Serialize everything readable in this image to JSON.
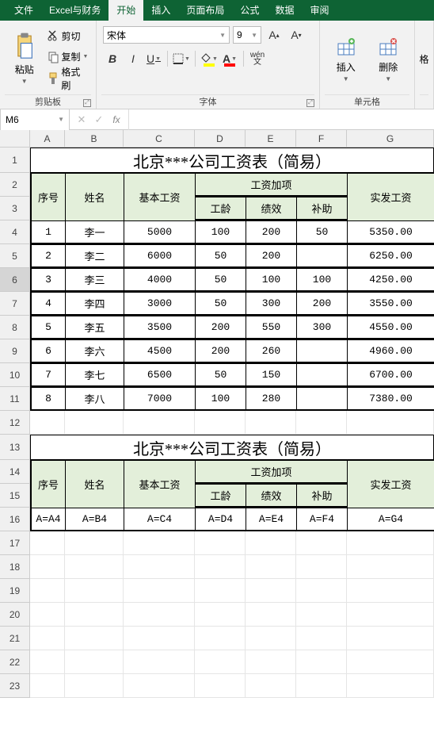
{
  "menu": {
    "items": [
      "文件",
      "Excel与财务",
      "开始",
      "插入",
      "页面布局",
      "公式",
      "数据",
      "审阅"
    ],
    "active": 2
  },
  "ribbon": {
    "clipboard": {
      "paste": "粘贴",
      "cut": "剪切",
      "copy": "复制",
      "format_painter": "格式刷",
      "label": "剪贴板"
    },
    "font": {
      "name": "宋体",
      "size": "9",
      "bold": "B",
      "italic": "I",
      "underline": "U",
      "increase": "A▴",
      "decrease": "A▾",
      "wen": "wén",
      "wen2": "文",
      "fontA": "A",
      "fillA": "A",
      "label": "字体"
    },
    "cells": {
      "insert": "插入",
      "delete": "删除",
      "format": "格",
      "label": "单元格"
    }
  },
  "namebox": "M6",
  "formula_bar": {
    "fx": "fx",
    "value": ""
  },
  "columns": [
    "A",
    "B",
    "C",
    "D",
    "E",
    "F",
    "G"
  ],
  "rows": [
    "1",
    "2",
    "3",
    "4",
    "5",
    "6",
    "7",
    "8",
    "9",
    "10",
    "11",
    "12",
    "13",
    "14",
    "15",
    "16",
    "17",
    "18",
    "19",
    "20",
    "21",
    "22",
    "23"
  ],
  "active_row": 6,
  "table1": {
    "title": "北京***公司工资表（简易）",
    "headers": {
      "seq": "序号",
      "name": "姓名",
      "base": "基本工资",
      "add_group": "工资加项",
      "tenure": "工龄",
      "perf": "绩效",
      "allow": "补助",
      "net": "实发工资"
    },
    "rows": [
      {
        "seq": "1",
        "name": "李一",
        "base": "5000",
        "tenure": "100",
        "perf": "200",
        "allow": "50",
        "net": "5350.00"
      },
      {
        "seq": "2",
        "name": "李二",
        "base": "6000",
        "tenure": "50",
        "perf": "200",
        "allow": "",
        "net": "6250.00"
      },
      {
        "seq": "3",
        "name": "李三",
        "base": "4000",
        "tenure": "50",
        "perf": "100",
        "allow": "100",
        "net": "4250.00"
      },
      {
        "seq": "4",
        "name": "李四",
        "base": "3000",
        "tenure": "50",
        "perf": "300",
        "allow": "200",
        "net": "3550.00"
      },
      {
        "seq": "5",
        "name": "李五",
        "base": "3500",
        "tenure": "200",
        "perf": "550",
        "allow": "300",
        "net": "4550.00"
      },
      {
        "seq": "6",
        "name": "李六",
        "base": "4500",
        "tenure": "200",
        "perf": "260",
        "allow": "",
        "net": "4960.00"
      },
      {
        "seq": "7",
        "name": "李七",
        "base": "6500",
        "tenure": "50",
        "perf": "150",
        "allow": "",
        "net": "6700.00"
      },
      {
        "seq": "8",
        "name": "李八",
        "base": "7000",
        "tenure": "100",
        "perf": "280",
        "allow": "",
        "net": "7380.00"
      }
    ]
  },
  "table2": {
    "title": "北京***公司工资表（简易）",
    "formulas": [
      "A=A4",
      "A=B4",
      "A=C4",
      "A=D4",
      "A=E4",
      "A=F4",
      "A=G4"
    ]
  }
}
